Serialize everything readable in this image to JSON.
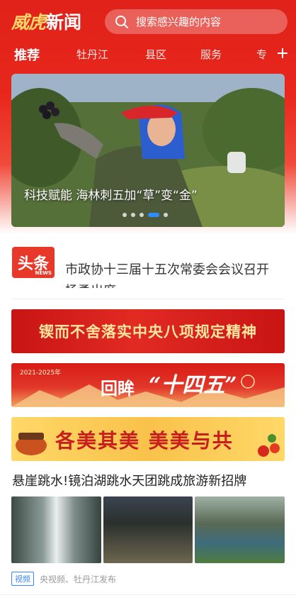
{
  "app": {
    "logo_part_a": "威虎",
    "logo_part_b": "新闻",
    "brand_color": "#e0221a"
  },
  "search": {
    "placeholder": "搜索感兴趣的内容"
  },
  "tabs": [
    {
      "label": "推荐",
      "active": true
    },
    {
      "label": "牡丹江",
      "active": false
    },
    {
      "label": "县区",
      "active": false
    },
    {
      "label": "服务",
      "active": false
    },
    {
      "label": "专",
      "active": false
    }
  ],
  "carousel": {
    "caption": "科技赋能 海林刺五加“草”变“金”",
    "slide_count": 5,
    "active_index": 3
  },
  "headline": {
    "badge": "头条",
    "badge_small": "NEWS",
    "text": "市政协十三届十五次常委会会议召开 杨勇出席"
  },
  "banners": {
    "b1": "锲而不舍落实中央八项规定精神",
    "b2_year": "2021-2025年",
    "b2_a": "回眸",
    "b2_b": "“十四五”",
    "b3": "各美其美 美美与共"
  },
  "video_news": {
    "title": "悬崖跳水!镜泊湖跳水天团跳成旅游新招牌",
    "tag": "视频",
    "source": "央视频、牡丹江发布"
  }
}
